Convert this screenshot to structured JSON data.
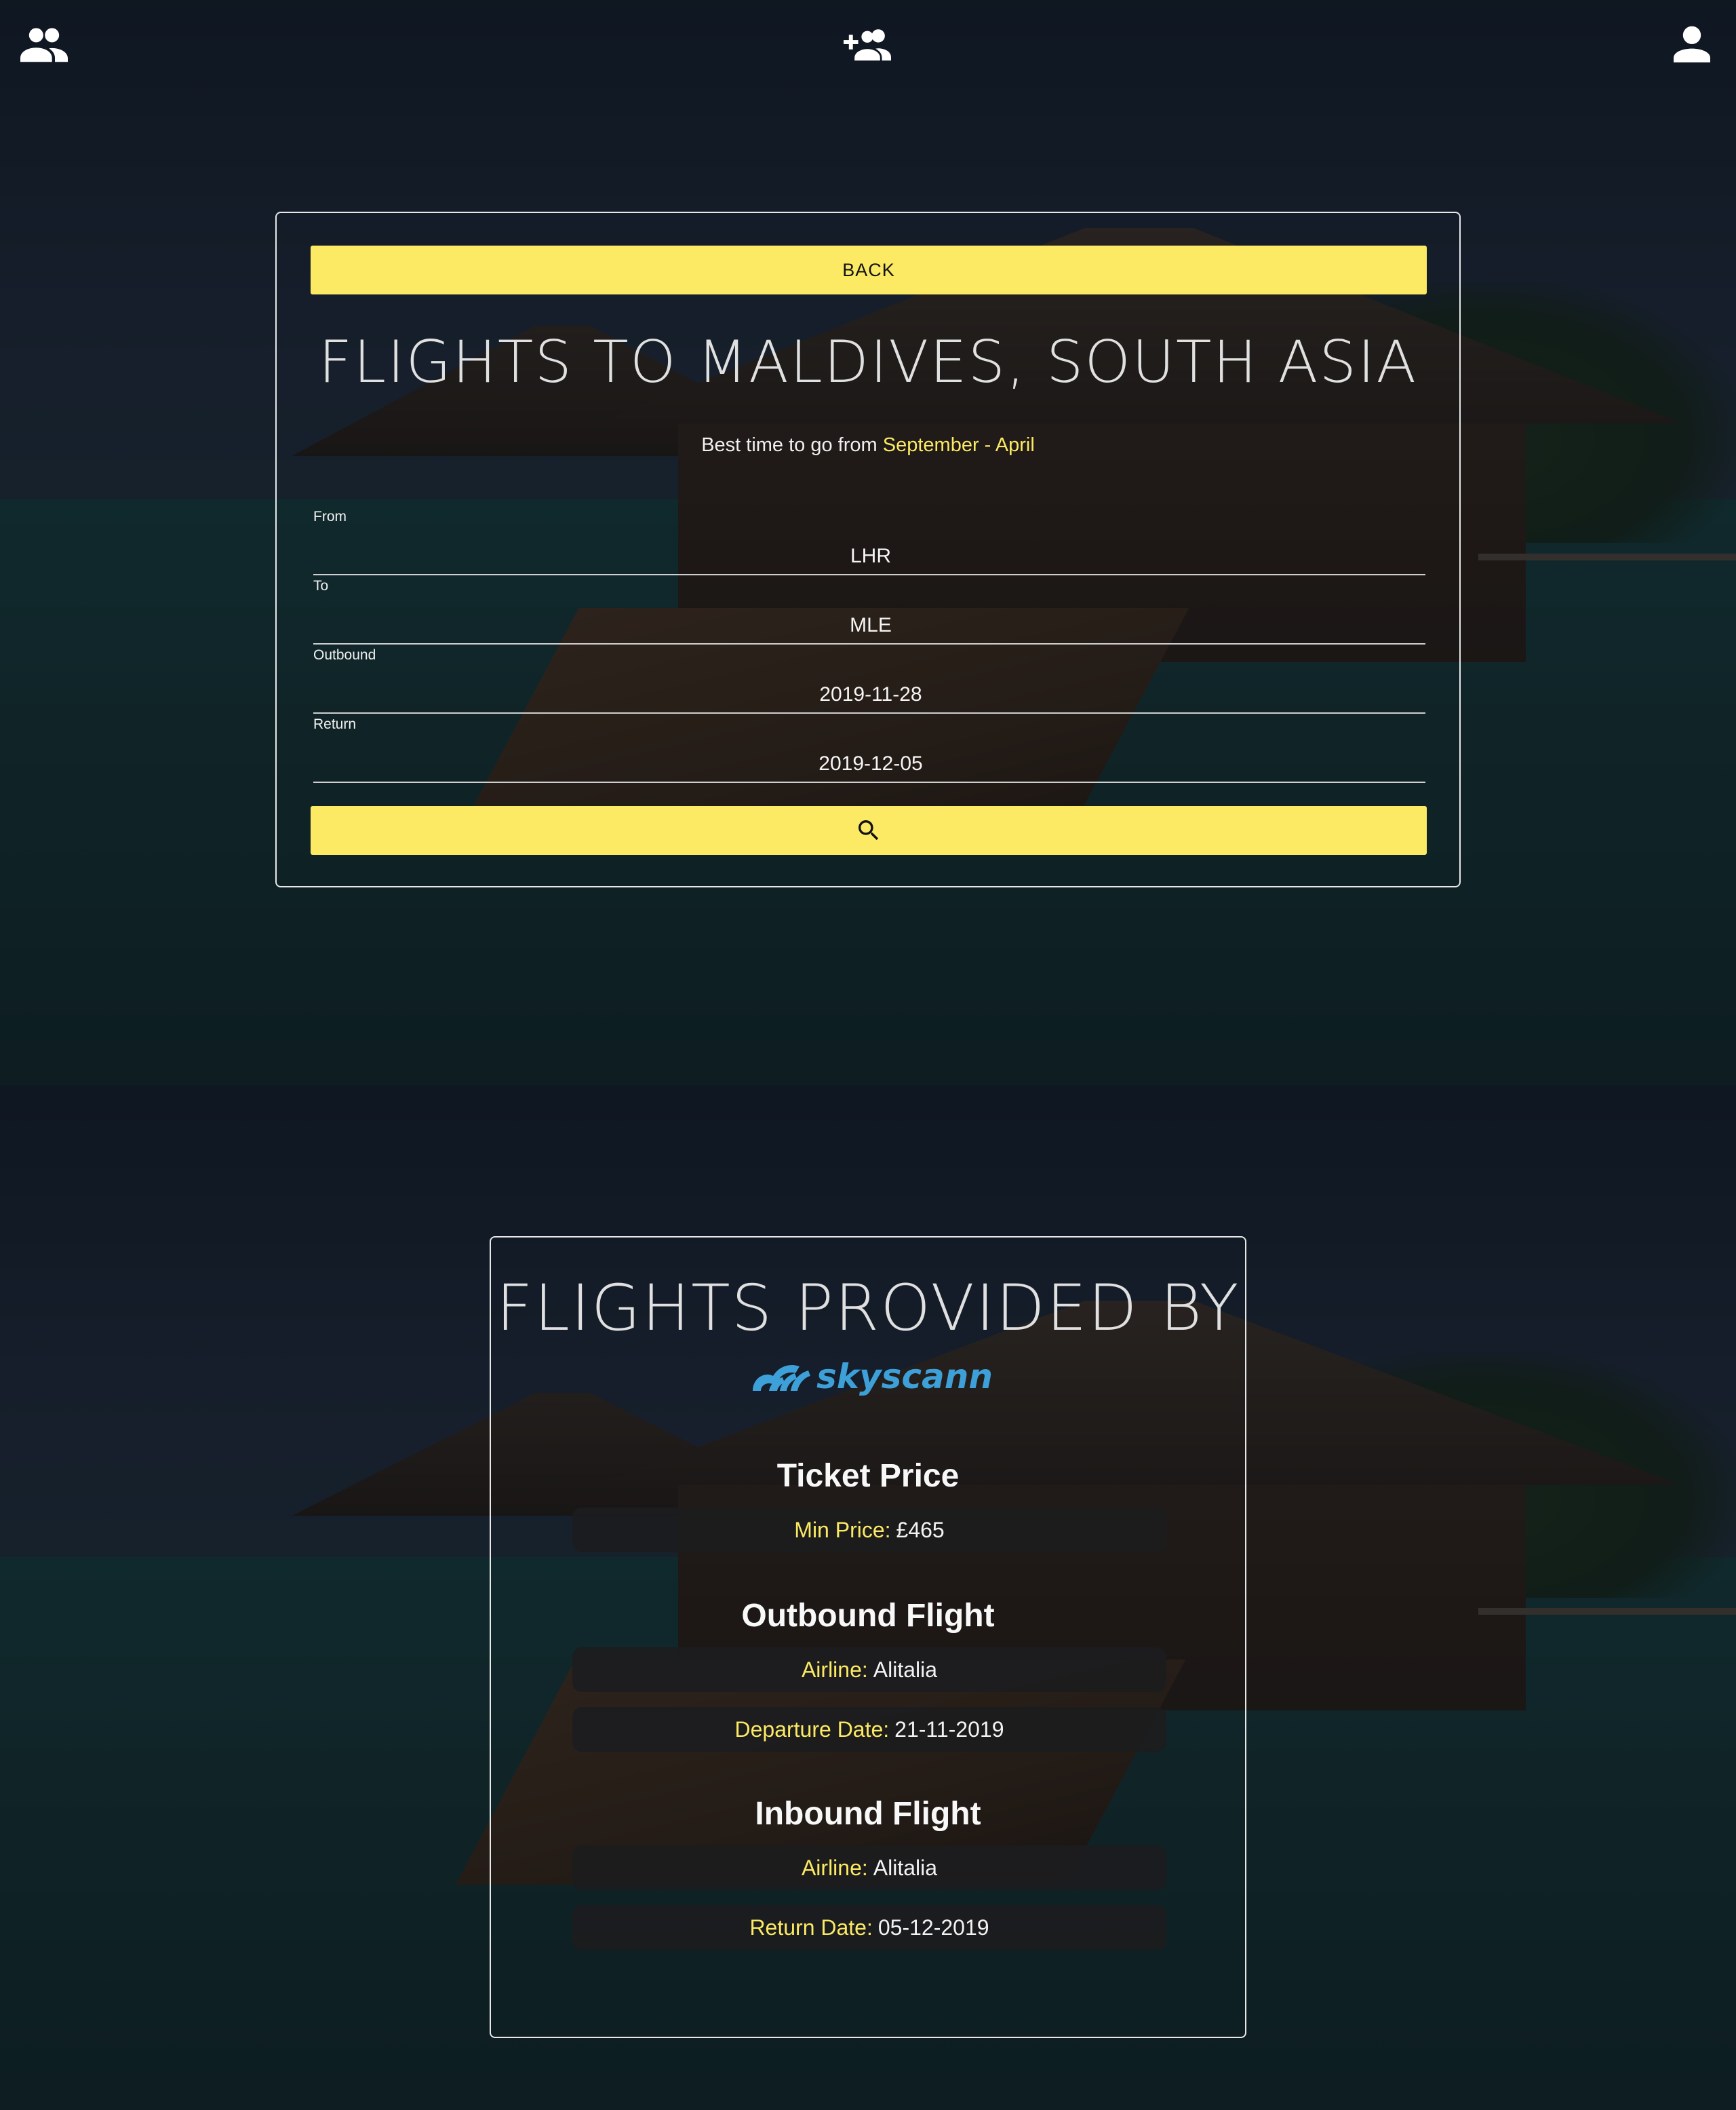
{
  "nav": {
    "left_icon": "group-icon",
    "center_icon": "add-group-icon",
    "right_icon": "person-icon"
  },
  "search": {
    "back_label": "BACK",
    "title": "FLIGHTS TO MALDIVES, SOUTH ASIA",
    "best_time_prefix": "Best time to go from",
    "best_time_range": "September - April",
    "fields": {
      "from": {
        "label": "From",
        "value": "LHR"
      },
      "to": {
        "label": "To",
        "value": "MLE"
      },
      "outbound": {
        "label": "Outbound",
        "value": "2019-11-28"
      },
      "return": {
        "label": "Return",
        "value": "2019-12-05"
      }
    },
    "search_icon": "search-icon"
  },
  "results": {
    "title": "FLIGHTS PROVIDED BY",
    "logo_text": "skyscanner",
    "ticket": {
      "heading": "Ticket Price",
      "min_price_label": "Min Price:",
      "min_price_value": "£465"
    },
    "outbound": {
      "heading": "Outbound Flight",
      "airline_label": "Airline:",
      "airline_value": "Alitalia",
      "date_label": "Departure Date:",
      "date_value": "21-11-2019"
    },
    "inbound": {
      "heading": "Inbound Flight",
      "airline_label": "Airline:",
      "airline_value": "Alitalia",
      "date_label": "Return Date:",
      "date_value": "05-12-2019"
    }
  },
  "colors": {
    "accent": "#fcea64",
    "button_bg": "#fcea64",
    "skyscanner_blue": "#3ea0d8"
  }
}
